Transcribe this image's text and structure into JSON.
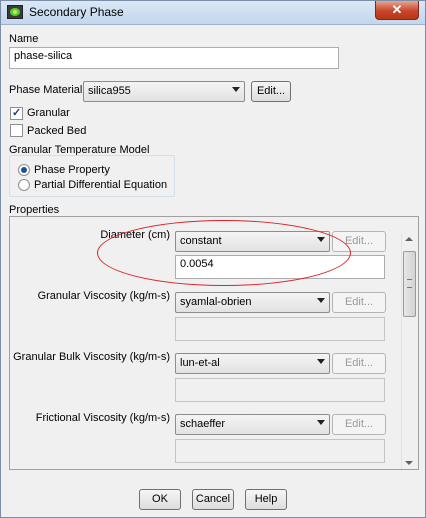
{
  "window": {
    "title": "Secondary Phase",
    "close_label": "✕"
  },
  "name": {
    "label": "Name",
    "value": "phase-silica"
  },
  "phase_material": {
    "label": "Phase Material",
    "value": "silica955",
    "edit_label": "Edit..."
  },
  "checkboxes": {
    "granular": {
      "label": "Granular",
      "checked": true
    },
    "packed_bed": {
      "label": "Packed Bed",
      "checked": false
    }
  },
  "granular_temperature_model": {
    "title": "Granular Temperature Model",
    "options": [
      {
        "label": "Phase Property",
        "selected": true
      },
      {
        "label": "Partial Differential Equation",
        "selected": false
      }
    ]
  },
  "properties": {
    "title": "Properties",
    "rows": [
      {
        "label": "Diameter (cm)",
        "method": "constant",
        "edit_label": "Edit...",
        "value": "0.0054"
      },
      {
        "label": "Granular Viscosity (kg/m-s)",
        "method": "syamlal-obrien",
        "edit_label": "Edit...",
        "value": ""
      },
      {
        "label": "Granular Bulk Viscosity (kg/m-s)",
        "method": "lun-et-al",
        "edit_label": "Edit...",
        "value": ""
      },
      {
        "label": "Frictional Viscosity (kg/m-s)",
        "method": "schaeffer",
        "edit_label": "Edit...",
        "value": ""
      }
    ]
  },
  "buttons": {
    "ok": "OK",
    "cancel": "Cancel",
    "help": "Help"
  },
  "colors": {
    "highlight": "#d9262a",
    "title_gradient": "#c3d6ec"
  }
}
